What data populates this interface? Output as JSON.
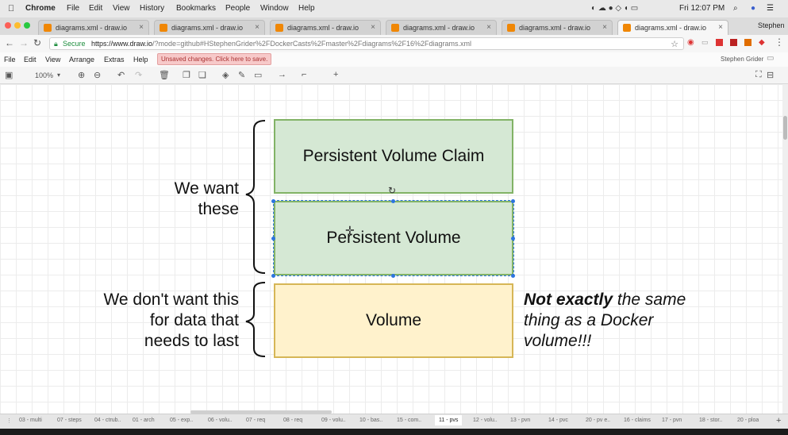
{
  "menubar": {
    "apple": "",
    "app": "Chrome",
    "items": [
      "File",
      "Edit",
      "View",
      "History",
      "Bookmarks",
      "People",
      "Window",
      "Help"
    ],
    "clock": "Fri 12:07 PM",
    "user": "Stephen"
  },
  "tabs": [
    {
      "title": "diagrams.xml - draw.io",
      "active": false
    },
    {
      "title": "diagrams.xml - draw.io",
      "active": false
    },
    {
      "title": "diagrams.xml - draw.io",
      "active": false
    },
    {
      "title": "diagrams.xml - draw.io",
      "active": false
    },
    {
      "title": "diagrams.xml - draw.io",
      "active": false
    },
    {
      "title": "diagrams.xml - draw.io",
      "active": true
    }
  ],
  "address": {
    "secure_label": "Secure",
    "url_domain": "https://www.draw.io",
    "url_rest": "/?mode=github#HStephenGrider%2FDockerCasts%2Fmaster%2Fdiagrams%2F16%2Fdiagrams.xml"
  },
  "drawio_menu": {
    "items": [
      "File",
      "Edit",
      "View",
      "Arrange",
      "Extras",
      "Help"
    ],
    "unsaved": "Unsaved changes. Click here to save.",
    "account": "Stephen Grider"
  },
  "toolbar": {
    "zoom": "100%"
  },
  "diagram": {
    "box_pvc": "Persistent Volume Claim",
    "box_pv": "Persistent Volume",
    "box_volume": "Volume",
    "label_want_line1": "We want",
    "label_want_line2": "these",
    "label_dont_line1": "We don't want this",
    "label_dont_line2": "for data that",
    "label_dont_line3": "needs to last",
    "note_bold": "Not exactly",
    "note_line1_rest": " the same",
    "note_line2": "thing as a Docker",
    "note_line3": "volume!!!"
  },
  "page_tabs": [
    "03 - multi",
    "07 - steps",
    "04 - ctrub..",
    "01 - arch",
    "05 - exp..",
    "06 - volu..",
    "07 - req",
    "08 - req",
    "09 - volu..",
    "10 - bas..",
    "15 - com..",
    "11 - pvs",
    "12 - volu..",
    "13 - pvn",
    "14 - pvc",
    "20 - pv e..",
    "16 - claims",
    "17 - pvn",
    "18 - stor..",
    "20 - ploa"
  ],
  "colors": {
    "green_fill": "#d5e8d4",
    "green_stroke": "#82b366",
    "yellow_fill": "#fff2cc",
    "yellow_stroke": "#d6b656",
    "tab_icon": "#f08705",
    "unsaved_bg": "#f7c9c9"
  },
  "icons": [
    "apple-icon",
    "tab-favicon",
    "close-tab-icon",
    "back-icon",
    "forward-icon",
    "reload-icon",
    "lock-icon",
    "star-icon",
    "undo-icon",
    "redo-icon",
    "trash-icon",
    "zoom-in-icon",
    "zoom-out-icon",
    "fill-icon",
    "line-color-icon",
    "shadow-icon",
    "arrow-icon",
    "waypoint-icon",
    "plus-icon",
    "fullscreen-icon"
  ]
}
